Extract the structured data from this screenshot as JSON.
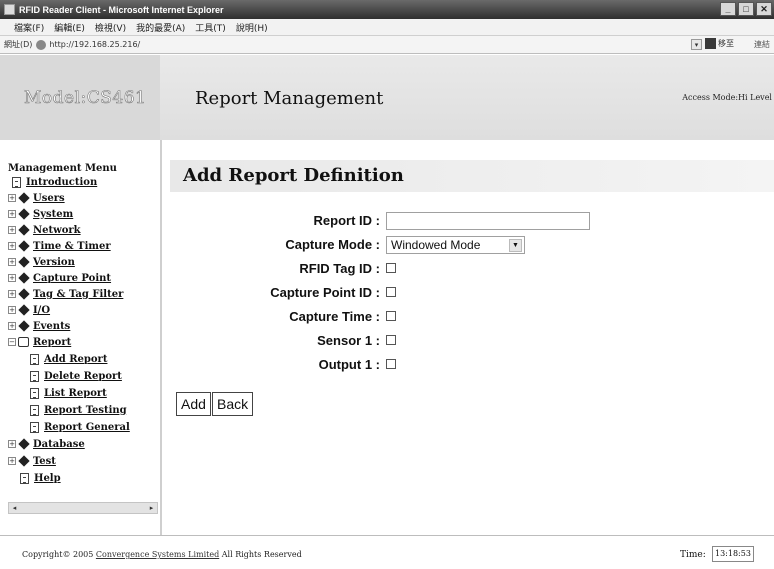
{
  "window": {
    "title": "RFID Reader Client - Microsoft Internet Explorer",
    "buttons": [
      "_",
      "□",
      "✕"
    ]
  },
  "menubar": {
    "items": [
      "檔案(F)",
      "編輯(E)",
      "檢視(V)",
      "我的最愛(A)",
      "工具(T)",
      "說明(H)"
    ]
  },
  "addressbar": {
    "label": "網址(D)",
    "url": "http://192.168.25.216/",
    "go_label": "移至",
    "links_label": "連結"
  },
  "header": {
    "model": "Model:CS461",
    "title": "Report Management",
    "access_mode": "Access Mode:Hi Level"
  },
  "sidebar": {
    "menu_title": "Management Menu",
    "items": [
      {
        "label": "Introduction"
      },
      {
        "label": "Users"
      },
      {
        "label": "System"
      },
      {
        "label": "Network"
      },
      {
        "label": "Time & Timer"
      },
      {
        "label": "Version"
      },
      {
        "label": "Capture Point"
      },
      {
        "label": "Tag & Tag Filter"
      },
      {
        "label": "I/O"
      },
      {
        "label": "Events"
      },
      {
        "label": "Report"
      },
      {
        "label": "Add Report"
      },
      {
        "label": "Delete Report"
      },
      {
        "label": "List Report"
      },
      {
        "label": "Report Testing"
      },
      {
        "label": "Report General"
      },
      {
        "label": "Database"
      },
      {
        "label": "Test"
      },
      {
        "label": "Help"
      }
    ]
  },
  "main": {
    "heading": "Add Report Definition",
    "fields": {
      "report_id_label": "Report ID :",
      "report_id_value": "",
      "capture_mode_label": "Capture Mode :",
      "capture_mode_value": "Windowed Mode",
      "rfid_tag_id_label": "RFID Tag ID :",
      "capture_point_id_label": "Capture Point ID :",
      "capture_time_label": "Capture Time :",
      "sensor1_label": "Sensor 1 :",
      "output1_label": "Output 1 :"
    },
    "buttons": {
      "add": "Add",
      "back": "Back"
    }
  },
  "footer": {
    "copyright_prefix": "Copyright© 2005",
    "copyright_link": "Convergence Systems Limited",
    "copyright_suffix": "All Rights Reserved",
    "time_label": "Time:",
    "time_value": "13:18:53"
  }
}
